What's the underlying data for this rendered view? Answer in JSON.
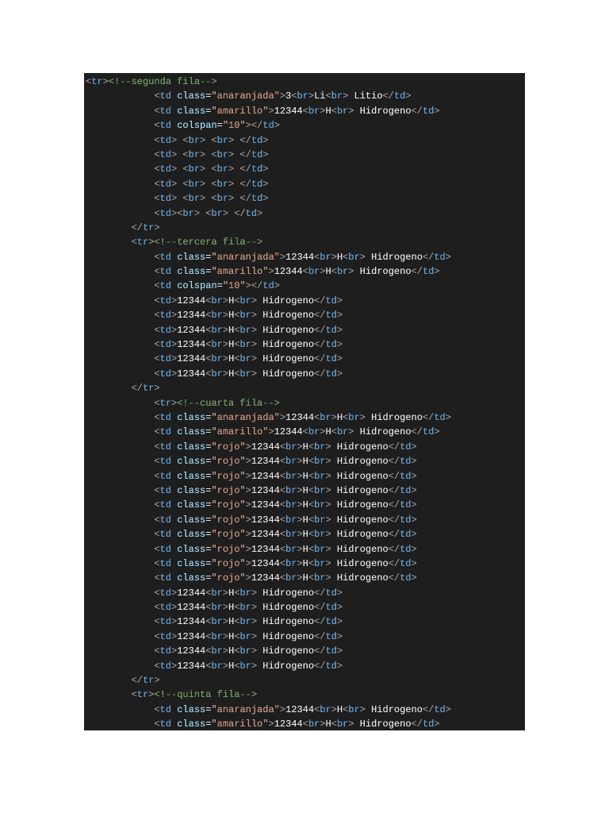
{
  "code_lines": [
    "<tr><!--segunda fila-->",
    "            <td class=\"anaranjada\">3<br>Li<br> Litio</td>",
    "            <td class=\"amarillo\">12344<br>H<br> Hidrogeno</td>",
    "            <td colspan=\"10\"></td>",
    "            <td> <br> <br> </td>",
    "            <td> <br> <br> </td>",
    "            <td> <br> <br> </td>",
    "            <td> <br> <br> </td>",
    "            <td> <br> <br> </td>",
    "            <td><br> <br> </td>",
    "        </tr>",
    "        <tr><!--tercera fila-->",
    "            <td class=\"anaranjada\">12344<br>H<br> Hidrogeno</td>",
    "            <td class=\"amarillo\">12344<br>H<br> Hidrogeno</td>",
    "            <td colspan=\"10\"></td>",
    "            <td>12344<br>H<br> Hidrogeno</td>",
    "            <td>12344<br>H<br> Hidrogeno</td>",
    "            <td>12344<br>H<br> Hidrogeno</td>",
    "            <td>12344<br>H<br> Hidrogeno</td>",
    "            <td>12344<br>H<br> Hidrogeno</td>",
    "            <td>12344<br>H<br> Hidrogeno</td>",
    "        </tr>",
    "            <tr><!--cuarta fila-->",
    "            <td class=\"anaranjada\">12344<br>H<br> Hidrogeno</td>",
    "            <td class=\"amarillo\">12344<br>H<br> Hidrogeno</td>",
    "            <td class=\"rojo\">12344<br>H<br> Hidrogeno</td>",
    "            <td class=\"rojo\">12344<br>H<br> Hidrogeno</td>",
    "            <td class=\"rojo\">12344<br>H<br> Hidrogeno</td>",
    "            <td class=\"rojo\">12344<br>H<br> Hidrogeno</td>",
    "            <td class=\"rojo\">12344<br>H<br> Hidrogeno</td>",
    "            <td class=\"rojo\">12344<br>H<br> Hidrogeno</td>",
    "            <td class=\"rojo\">12344<br>H<br> Hidrogeno</td>",
    "            <td class=\"rojo\">12344<br>H<br> Hidrogeno</td>",
    "            <td class=\"rojo\">12344<br>H<br> Hidrogeno</td>",
    "            <td class=\"rojo\">12344<br>H<br> Hidrogeno</td>",
    "            <td>12344<br>H<br> Hidrogeno</td>",
    "            <td>12344<br>H<br> Hidrogeno</td>",
    "            <td>12344<br>H<br> Hidrogeno</td>",
    "            <td>12344<br>H<br> Hidrogeno</td>",
    "            <td>12344<br>H<br> Hidrogeno</td>",
    "            <td>12344<br>H<br> Hidrogeno</td>",
    "        </tr>",
    "        <tr><!--quinta fila-->",
    "            <td class=\"anaranjada\">12344<br>H<br> Hidrogeno</td>",
    "            <td class=\"amarillo\">12344<br>H<br> Hidrogeno</td>"
  ],
  "colors": {
    "background": "#1e1e1e",
    "punctuation": "#808080",
    "tag": "#569cd6",
    "attribute": "#9cdcfe",
    "string": "#ce9178",
    "comment": "#6a9955",
    "text": "#d4d4d4"
  }
}
